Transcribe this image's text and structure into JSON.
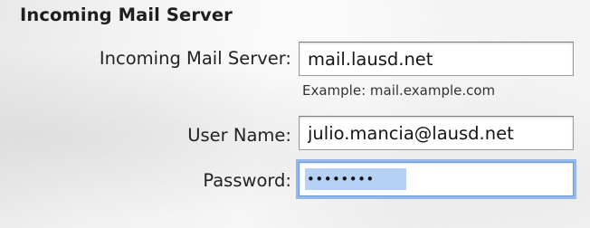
{
  "section": {
    "title": "Incoming Mail Server"
  },
  "fields": {
    "server": {
      "label": "Incoming Mail Server:",
      "value": "mail.lausd.net",
      "hint": "Example: mail.example.com"
    },
    "username": {
      "label": "User Name:",
      "value": "julio.mancia@lausd.net"
    },
    "password": {
      "label": "Password:",
      "masked_value": "••••••••",
      "state": "focused, text selected"
    }
  },
  "colors": {
    "focus_ring": "#78a5e6",
    "selection": "#b5d1f6"
  }
}
